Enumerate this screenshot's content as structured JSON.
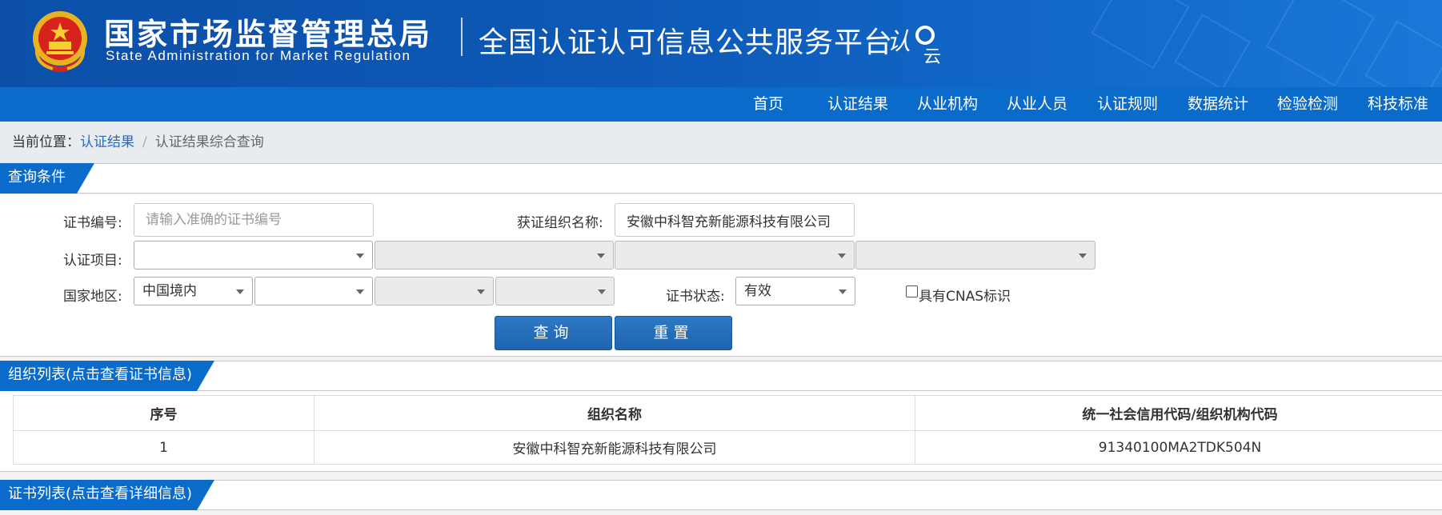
{
  "header": {
    "title_cn": "国家市场监督管理总局",
    "title_en": "State Administration  for  Market Regulation",
    "platform": "全国认证认可信息公共服务平台",
    "logo_text": "认云"
  },
  "nav": {
    "items": [
      "首页",
      "认证结果",
      "从业机构",
      "从业人员",
      "认证规则",
      "数据统计",
      "检验检测",
      "科技标准"
    ]
  },
  "breadcrumb": {
    "prefix": "当前位置：",
    "link": "认证结果",
    "sep": "/",
    "current": "认证结果综合查询"
  },
  "query_section": {
    "title": "查询条件",
    "cert_no_label": "证书编号:",
    "cert_no_placeholder": "请输入准确的证书编号",
    "org_name_label": "获证组织名称:",
    "org_name_value": "安徽中科智充新能源科技有限公司",
    "project_label": "认证项目:",
    "region_label": "国家地区:",
    "region_value": "中国境内",
    "status_label": "证书状态:",
    "status_value": "有效",
    "cnas_label": "具有CNAS标识",
    "query_button": "查询",
    "reset_button": "重置"
  },
  "org_section": {
    "title": "组织列表(点击查看证书信息)",
    "columns": [
      "序号",
      "组织名称",
      "统一社会信用代码/组织机构代码"
    ],
    "rows": [
      {
        "index": "1",
        "name": "安徽中科智充新能源科技有限公司",
        "code": "91340100MA2TDK504N"
      }
    ]
  },
  "cert_section": {
    "title": "证书列表(点击查看详细信息)"
  },
  "colors": {
    "primary": "#0b6bcb",
    "button": "#1e64ae",
    "link": "#2a6ab8"
  }
}
